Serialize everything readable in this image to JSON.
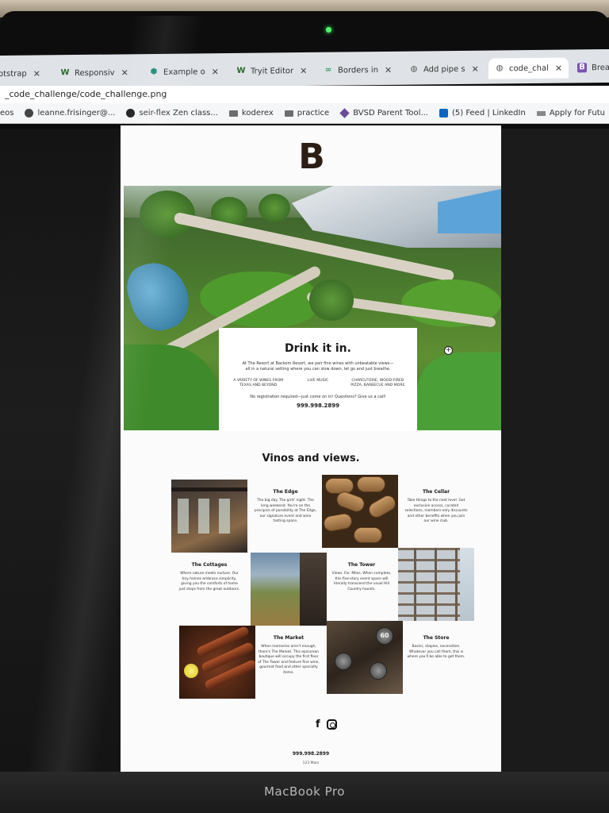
{
  "laptop": {
    "brand": "MacBook Pro"
  },
  "browser": {
    "tabs": [
      {
        "label": "otstrap",
        "icon": "bootstrap-icon",
        "icon_color": "#7952b3"
      },
      {
        "label": "Responsiv",
        "icon": "w-icon",
        "icon_color": "#2a6b2a"
      },
      {
        "label": "Example o",
        "icon": "hexagon-icon",
        "icon_color": "#1f8a7a"
      },
      {
        "label": "Tryit Editor",
        "icon": "w-icon",
        "icon_color": "#2a6b2a"
      },
      {
        "label": "Borders in",
        "icon": "dots-icon",
        "icon_color": "#3a9a5a"
      },
      {
        "label": "Add pipe s",
        "icon": "globe-icon",
        "icon_color": "#555555"
      },
      {
        "label": "code_chal",
        "icon": "globe-icon",
        "icon_color": "#555555"
      },
      {
        "label": "Brea",
        "icon": "bootstrap-icon",
        "icon_color": "#7952b3"
      }
    ],
    "close_glyph": "✕",
    "address": "_code_challenge/code_challenge.png",
    "bookmarks": [
      {
        "label": "eos",
        "icon": ""
      },
      {
        "label": "leanne.frisinger@...",
        "icon": "globe-icon"
      },
      {
        "label": "seir-flex Zen class...",
        "icon": "github-icon"
      },
      {
        "label": "koderex",
        "icon": "folder-icon"
      },
      {
        "label": "practice",
        "icon": "folder-icon"
      },
      {
        "label": "BVSD Parent Tool...",
        "icon": "diamond-icon"
      },
      {
        "label": "(5) Feed | LinkedIn",
        "icon": "linkedin-icon"
      },
      {
        "label": "Apply for Futu",
        "icon": "text-icon"
      }
    ]
  },
  "site": {
    "logo": "B",
    "hero_card": {
      "title": "Drink it in.",
      "description": "At The Resort at Backom Resort, we pair fine wines with unbeatable views— all in a natural setting where you can slow down, let go and just breathe.",
      "features": [
        "A VARIETY OF WINES FROM TEXAS AND BEYOND",
        "LIVE MUSIC",
        "CHARCUTERIE, WOOD-FIRED PIZZA, BARBECUE AND MORE"
      ],
      "note": "No registration required—just come on in! Questions? Give us a call!",
      "phone": "999.998.2899"
    },
    "section_title": "Vinos and views.",
    "venues": [
      {
        "title": "The Edge",
        "text": "The big day. The girls' night. The long weekend. You're on the precipice of possibility at The Edge, our signature event and wine tasting space."
      },
      {
        "title": "The Cellar",
        "text": "Take things to the next level. Get exclusive access, curated selections, members-only discounts and other benefits when you join our wine club."
      },
      {
        "title": "The Cottages",
        "text": "Where nature meets nurture. Our tiny homes embrace simplicity, giving you the comforts of home just steps from the great outdoors."
      },
      {
        "title": "The Tower",
        "text": "Views. For. Miles. When complete, this five-story event space will literally transcend the usual Hill Country haunts."
      },
      {
        "title": "The Market",
        "text": "When memories aren't enough, there's The Market. This epicurean boutique will occupy the first floor of The Tower and feature fine wine, gourmet food and other specialty items."
      },
      {
        "title": "The Store",
        "text": "Basics, staples, necessities. Whatever you call them, this is where you'll be able to get them."
      }
    ],
    "wine_cap_label": "60",
    "footer": {
      "phone": "999.998.2899",
      "address": "123 Main"
    }
  }
}
